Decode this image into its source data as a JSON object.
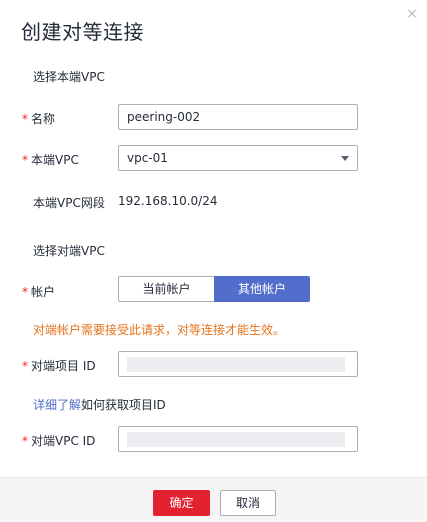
{
  "dialog": {
    "title": "创建对等连接",
    "close_symbol": "×"
  },
  "local": {
    "section_title": "选择本端VPC",
    "name_label": "名称",
    "name_value": "peering-002",
    "vpc_label": "本端VPC",
    "vpc_value": "vpc-01",
    "cidr_label": "本端VPC网段",
    "cidr_value": "192.168.10.0/24"
  },
  "peer": {
    "section_title": "选择对端VPC",
    "account_label": "帐户",
    "account_options": [
      "当前帐户",
      "其他帐户"
    ],
    "account_selected": "其他帐户",
    "warning": "对端帐户需要接受此请求，对等连接才能生效。",
    "project_id_label": "对端项目 ID",
    "learn_link": "详细了解",
    "learn_rest": "如何获取项目ID",
    "vpc_id_label": "对端VPC ID"
  },
  "required_mark": "*",
  "footer": {
    "ok_label": "确定",
    "cancel_label": "取消"
  },
  "colors": {
    "primary": "#526ecc",
    "danger": "#e3212f",
    "warning": "#e5731c",
    "required": "#f5222d"
  }
}
